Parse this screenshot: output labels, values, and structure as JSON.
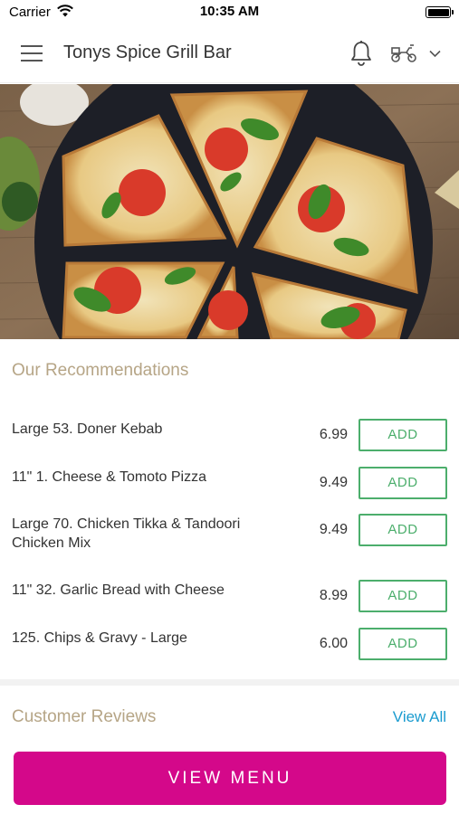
{
  "status_bar": {
    "carrier": "Carrier",
    "time": "10:35 AM"
  },
  "header": {
    "title": "Tonys Spice Grill Bar",
    "icons": [
      "menu-icon",
      "bell-icon",
      "scooter-icon",
      "chevron-down-icon"
    ]
  },
  "hero": {
    "image": "pizza-photo"
  },
  "recommendations": {
    "title": "Our Recommendations",
    "items": [
      {
        "name": "Large 53. Doner Kebab",
        "price": "6.99",
        "button": "ADD"
      },
      {
        "name": "11\" 1. Cheese & Tomoto Pizza",
        "price": "9.49",
        "button": "ADD"
      },
      {
        "name": "Large 70. Chicken Tikka & Tandoori Chicken Mix",
        "price": "9.49",
        "button": "ADD"
      },
      {
        "name": "11\" 32. Garlic Bread with Cheese",
        "price": "8.99",
        "button": "ADD"
      },
      {
        "name": "125. Chips & Gravy - Large",
        "price": "6.00",
        "button": "ADD"
      }
    ]
  },
  "reviews": {
    "title": "Customer Reviews",
    "view_all": "View All"
  },
  "footer": {
    "button": "VIEW MENU"
  },
  "colors": {
    "accent": "#d4088a",
    "add_green": "#4cae6c",
    "section_title": "#b6a586",
    "link": "#1a9bcf"
  }
}
